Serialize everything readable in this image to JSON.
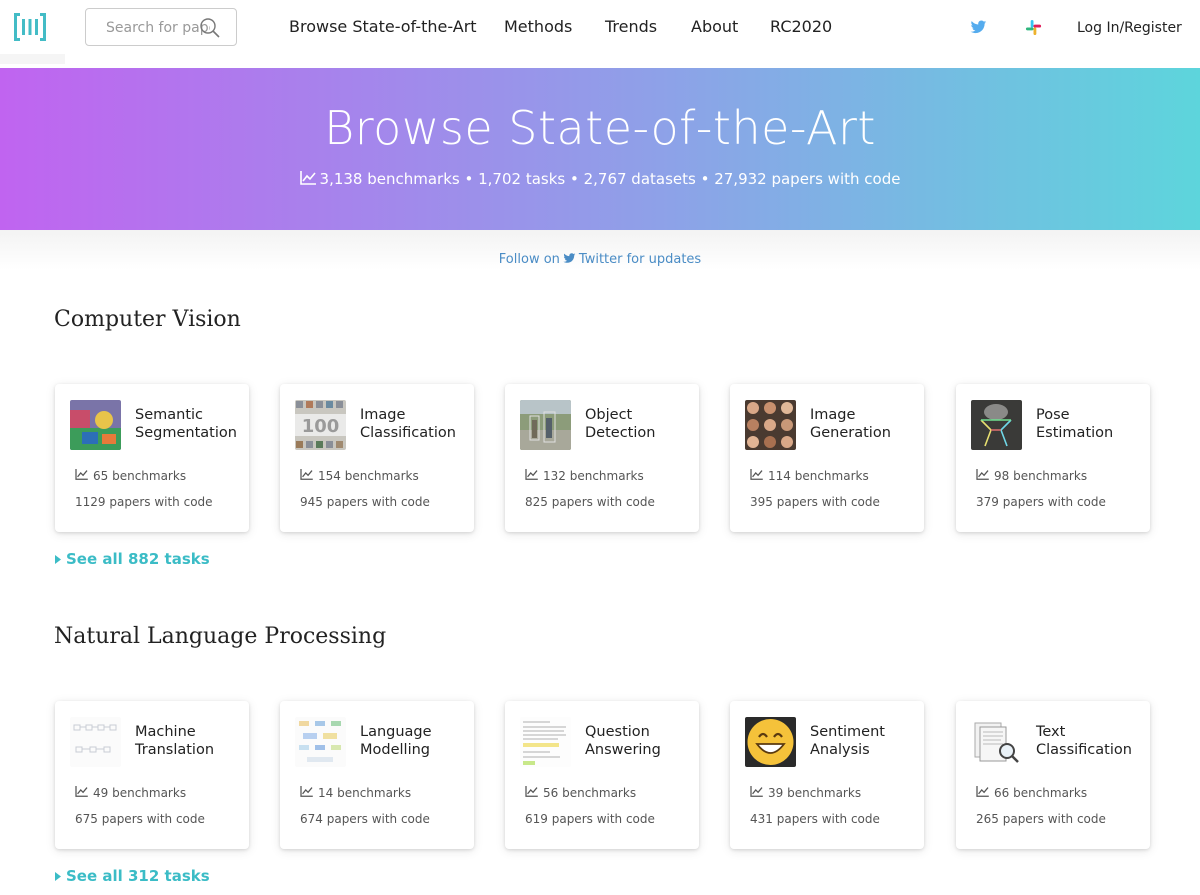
{
  "nav": {
    "search_placeholder": "Search for papers",
    "links": [
      "Browse State-of-the-Art",
      "Methods",
      "Trends",
      "About",
      "RC2020"
    ],
    "login": "Log In/Register",
    "icons": [
      "twitter-icon",
      "slack-icon"
    ]
  },
  "hero": {
    "title": "Browse State-of-the-Art",
    "stats": "3,138 benchmarks • 1,702 tasks • 2,767 datasets • 27,932 papers with code"
  },
  "follow": {
    "before": "Follow on",
    "after": "Twitter for updates"
  },
  "colors": {
    "gradient_start": "#c064f0",
    "gradient_mid": "#8ea1e8",
    "gradient_end": "#5dd5dc",
    "accent": "#3bbcc6",
    "link": "#4a8cc5"
  },
  "sections": [
    {
      "title": "Computer Vision",
      "tasks": [
        {
          "name": "Semantic Segmentation",
          "benchmarks": "65 benchmarks",
          "papers": "1129 papers with code"
        },
        {
          "name": "Image Classification",
          "benchmarks": "154 benchmarks",
          "papers": "945 papers with code"
        },
        {
          "name": "Object Detection",
          "benchmarks": "132 benchmarks",
          "papers": "825 papers with code"
        },
        {
          "name": "Image Generation",
          "benchmarks": "114 benchmarks",
          "papers": "395 papers with code"
        },
        {
          "name": "Pose Estimation",
          "benchmarks": "98 benchmarks",
          "papers": "379 papers with code"
        }
      ],
      "see_all": "See all 882 tasks"
    },
    {
      "title": "Natural Language Processing",
      "tasks": [
        {
          "name": "Machine Translation",
          "benchmarks": "49 benchmarks",
          "papers": "675 papers with code"
        },
        {
          "name": "Language Modelling",
          "benchmarks": "14 benchmarks",
          "papers": "674 papers with code"
        },
        {
          "name": "Question Answering",
          "benchmarks": "56 benchmarks",
          "papers": "619 papers with code"
        },
        {
          "name": "Sentiment Analysis",
          "benchmarks": "39 benchmarks",
          "papers": "431 papers with code"
        },
        {
          "name": "Text Classification",
          "benchmarks": "66 benchmarks",
          "papers": "265 papers with code"
        }
      ],
      "see_all": "See all 312 tasks"
    }
  ]
}
